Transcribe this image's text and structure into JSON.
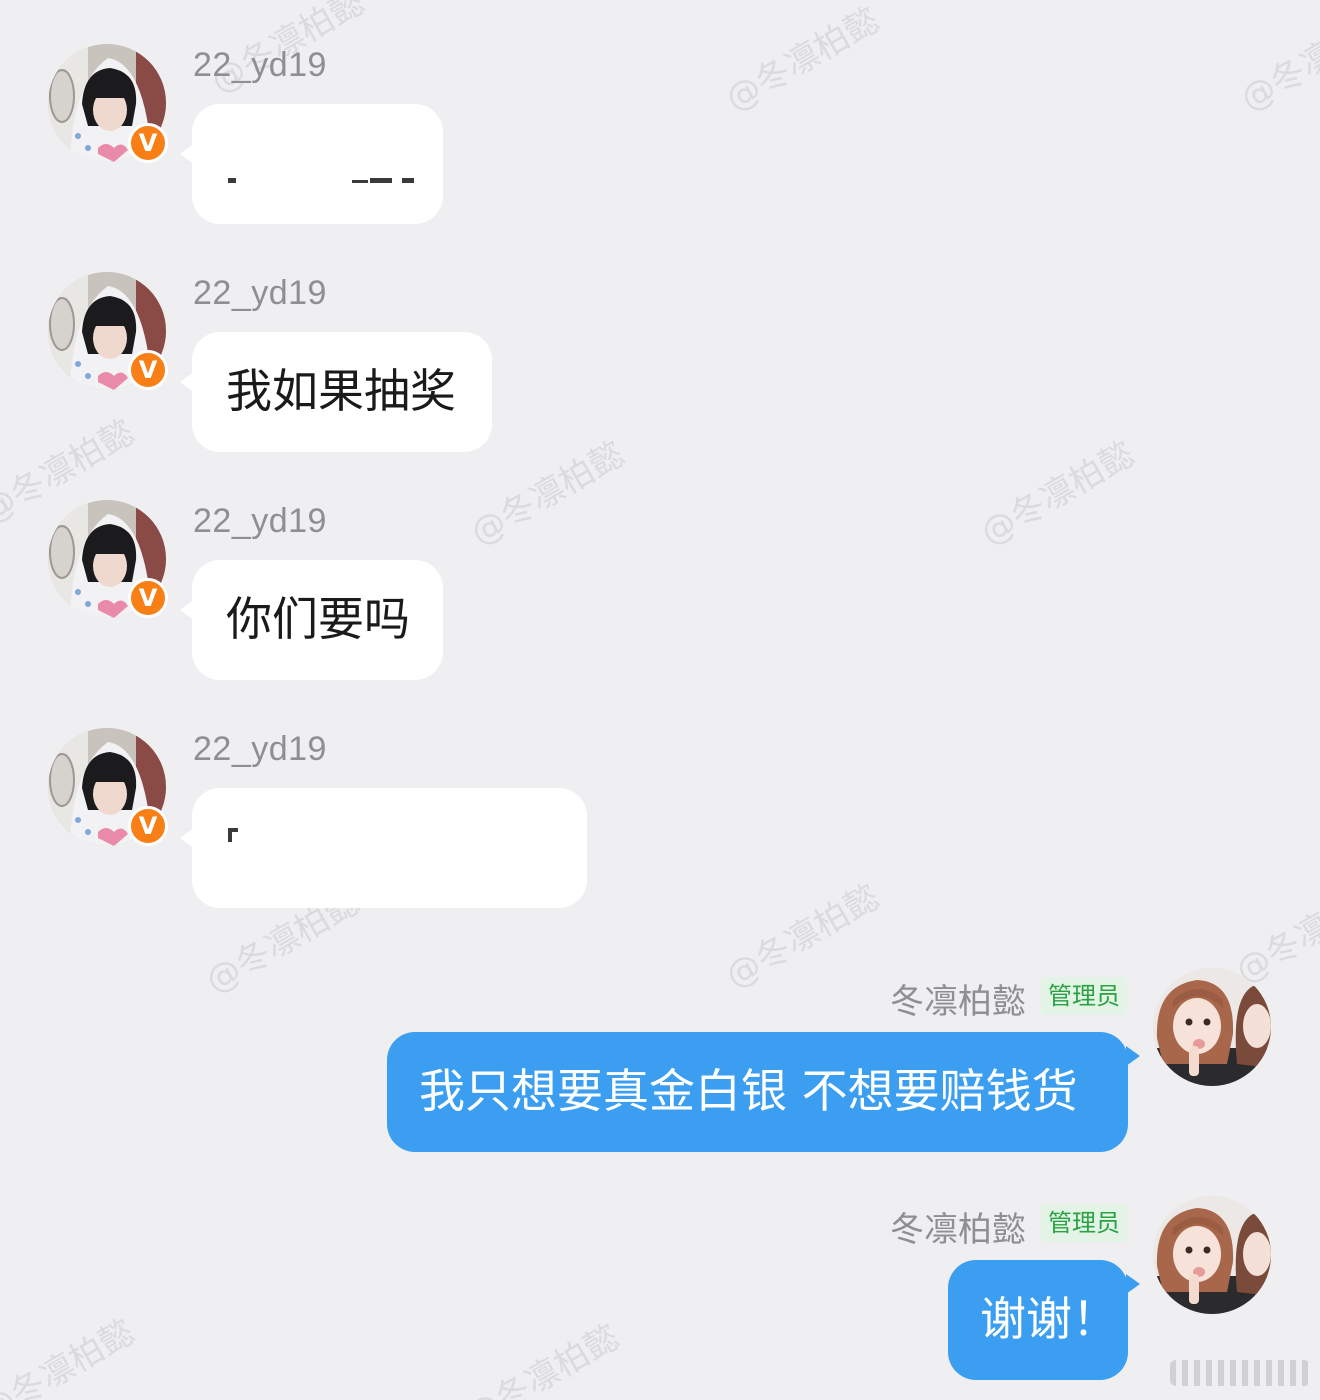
{
  "watermark": {
    "text": "@冬凛柏懿"
  },
  "incoming": [
    {
      "username": "22_yd19",
      "badge": "V",
      "text": "",
      "redacted": true
    },
    {
      "username": "22_yd19",
      "badge": "V",
      "text": "我如果抽奖",
      "redacted": false
    },
    {
      "username": "22_yd19",
      "badge": "V",
      "text": "你们要吗",
      "redacted": false
    },
    {
      "username": "22_yd19",
      "badge": "V",
      "text": "",
      "redacted": true
    }
  ],
  "outgoing": [
    {
      "sender": "冬凛柏懿",
      "role": "管理员",
      "text": "我只想要真金白银 不想要赔钱货"
    },
    {
      "sender": "冬凛柏懿",
      "role": "管理员",
      "text": "谢谢！"
    }
  ],
  "colors": {
    "background": "#efeff1",
    "incoming_bubble": "#ffffff",
    "outgoing_bubble": "#3b9ef0",
    "verified_badge": "#f77f16",
    "admin_badge_bg": "#e3f4e6",
    "admin_badge_text": "#2aa142",
    "username_text": "#8e8e93"
  },
  "icons": {
    "verified": "verified-v-badge-icon",
    "incoming_avatar": "user-avatar-hoodie-photo",
    "outgoing_avatar": "admin-avatar-photo"
  }
}
